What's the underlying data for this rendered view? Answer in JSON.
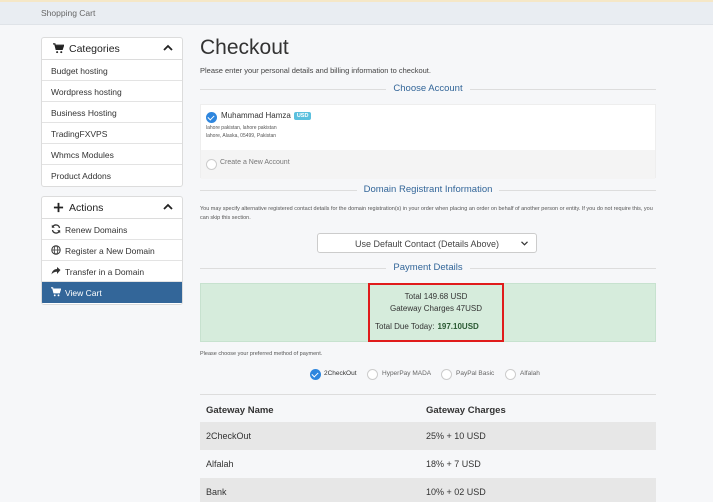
{
  "breadcrumb": "Shopping Cart",
  "sidebar": {
    "categories": {
      "title": "Categories",
      "items": [
        "Budget hosting",
        "Wordpress hosting",
        "Business Hosting",
        "TradingFXVPS",
        "Whmcs Modules",
        "Product Addons"
      ]
    },
    "actions": {
      "title": "Actions",
      "items": [
        {
          "label": "Renew Domains",
          "icon": "refresh-icon"
        },
        {
          "label": "Register a New Domain",
          "icon": "globe-icon"
        },
        {
          "label": "Transfer in a Domain",
          "icon": "share-arrow-icon"
        },
        {
          "label": "View Cart",
          "icon": "cart-icon",
          "active": true
        }
      ]
    }
  },
  "main": {
    "title": "Checkout",
    "subtitle": "Please enter your personal details and billing information to checkout.",
    "choose_account": {
      "heading": "Choose Account",
      "account_name": "Muhammad Hamza",
      "account_badge": "USD",
      "address_line1": "lahore pakistan, lahore pakistan",
      "address_line2": "lahore, Alaska, 05499, Pakistan",
      "create_new": "Create a New Account"
    },
    "domain_registrant": {
      "heading": "Domain Registrant Information",
      "description": "You may specify alternative registered contact details for the domain registration(s) in your order when placing an order on behalf of another person or entity. If you do not require this, you can skip this section.",
      "select_value": "Use Default Contact (Details Above)"
    },
    "payment_details": {
      "heading": "Payment Details",
      "total": "Total 149.68 USD",
      "gateway_charges": "Gateway Charges 47USD",
      "due_label": "Total Due Today:",
      "due_value": "197.10USD"
    },
    "payment_method": {
      "label": "Please choose your preferred method of payment.",
      "options": [
        "2CheckOut",
        "HyperPay MADA",
        "PayPal Basic",
        "Alfalah"
      ],
      "selected": "2CheckOut"
    },
    "gateway_table": {
      "headers": [
        "Gateway Name",
        "Gateway Charges"
      ],
      "rows": [
        [
          "2CheckOut",
          "25% + 10 USD"
        ],
        [
          "Alfalah",
          "18% + 7 USD"
        ],
        [
          "Bank",
          "10% + 02 USD"
        ]
      ]
    }
  },
  "colors": {
    "accent": "#336699",
    "success_bg": "#d6ecdc",
    "highlight": "#e01b1b",
    "radio": "#2e86de"
  }
}
